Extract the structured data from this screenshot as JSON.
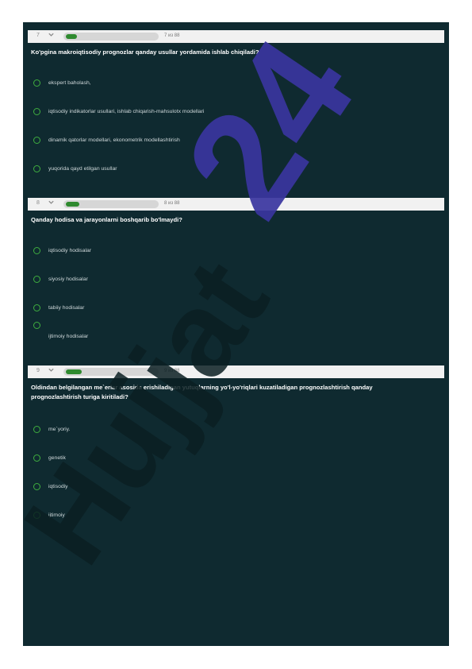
{
  "colors": {
    "panel_bg": "#0f2a30",
    "bar_bg": "#f1f1f1",
    "progress_fill": "#2f8a2f",
    "radio_border": "#3fae3f",
    "question_text": "#ffffff",
    "option_text": "#cfd8da",
    "watermark_blue": "#3a35a0",
    "watermark_dark": "#0a1e22"
  },
  "watermark": {
    "text": "Hujjat",
    "number": "24"
  },
  "questions": [
    {
      "number": "7",
      "count": "7 из 88",
      "progress": 0.05,
      "text": "Ko'pgina makroiqtisodiy prognozlar qanday  usullar yordamida ishlab chiqiladi?",
      "options": [
        "ekspert baholash,",
        "iqtisodiy indikatorlar usullari, ishlab chiqarish-mahsulotx modellari",
        "dinamik qatorlar modellari, ekonometrik modellashtirish",
        "yuqorida qayd etilgan usullar"
      ]
    },
    {
      "number": "8",
      "count": "8 из 88",
      "progress": 0.06,
      "text": "Qanday hodisa va jarayonlarni boshqarib bo'lmaydi?",
      "options": [
        "iqtisodiy hodisalar",
        "siyosiy hodisalar",
        "tabiiy hodisalar",
        "ijtimoiy hodisalar"
      ]
    },
    {
      "number": "9",
      "count": "9 из 88",
      "progress": 0.07,
      "text_line1": "Oldindan belgilangan me`erlar asosida erishiladigan  yutuqlarning  yo'l-yo'riqlari  kuzatiladigan prognozlashtirish qanday",
      "text_line2": "prognozlashtirish turiga kiritiladi?",
      "options": [
        "me`yoriy.",
        "genetik",
        "iqtisodiy",
        "ijtimoiy"
      ]
    }
  ]
}
